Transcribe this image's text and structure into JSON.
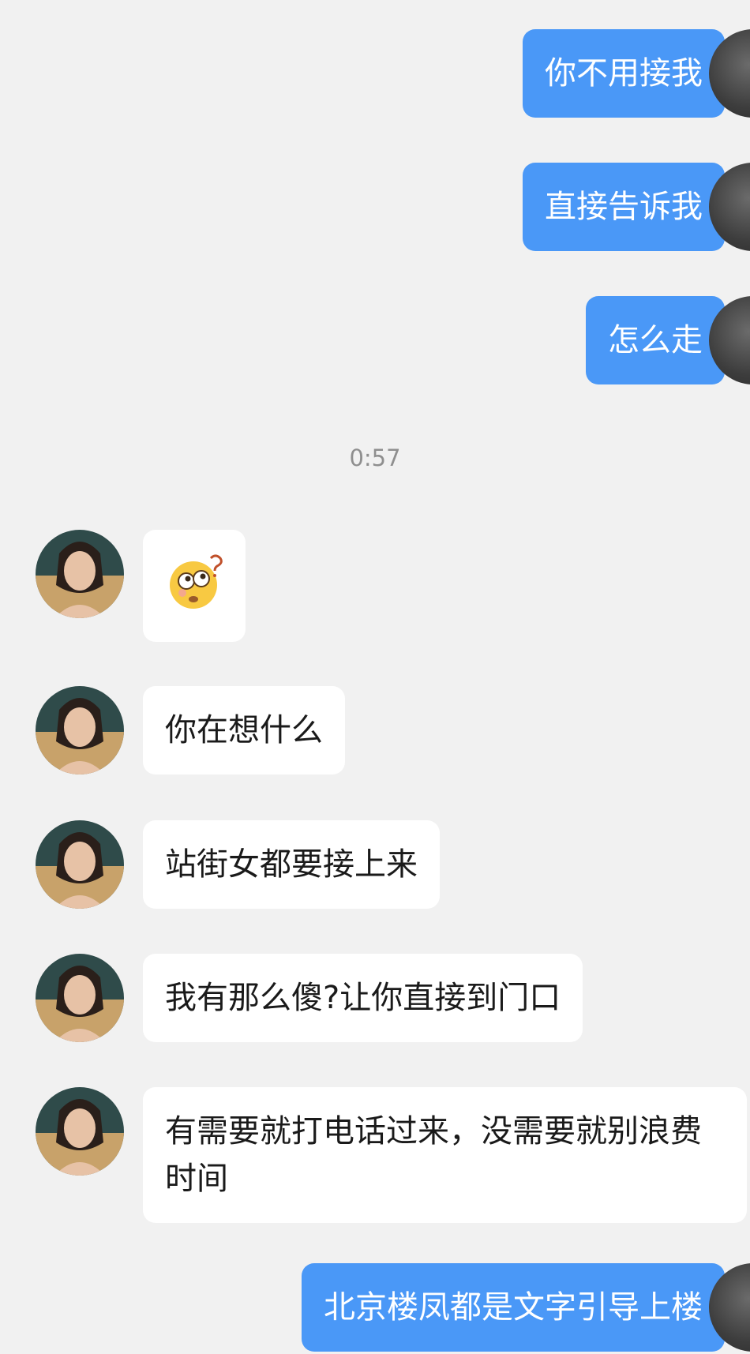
{
  "outgoing": [
    {
      "text": "你不用接我"
    },
    {
      "text": "直接告诉我"
    },
    {
      "text": "怎么走"
    },
    {
      "text": "北京楼凤都是文字引导上楼"
    }
  ],
  "timestamp": "0:57",
  "incoming": [
    {
      "type": "emoji",
      "emoji_name": "confused-face-with-question-mark"
    },
    {
      "type": "text",
      "text": "你在想什么"
    },
    {
      "type": "text",
      "text": "站街女都要接上来"
    },
    {
      "type": "text",
      "text": "我有那么傻?让你直接到门口"
    },
    {
      "type": "text",
      "text": "有需要就打电话过来，没需要就别浪费时间"
    }
  ],
  "colors": {
    "background": "#f1f1f1",
    "outgoing_bubble": "#4a98f7",
    "incoming_bubble": "#ffffff",
    "timestamp_text": "#8f8f8f"
  }
}
